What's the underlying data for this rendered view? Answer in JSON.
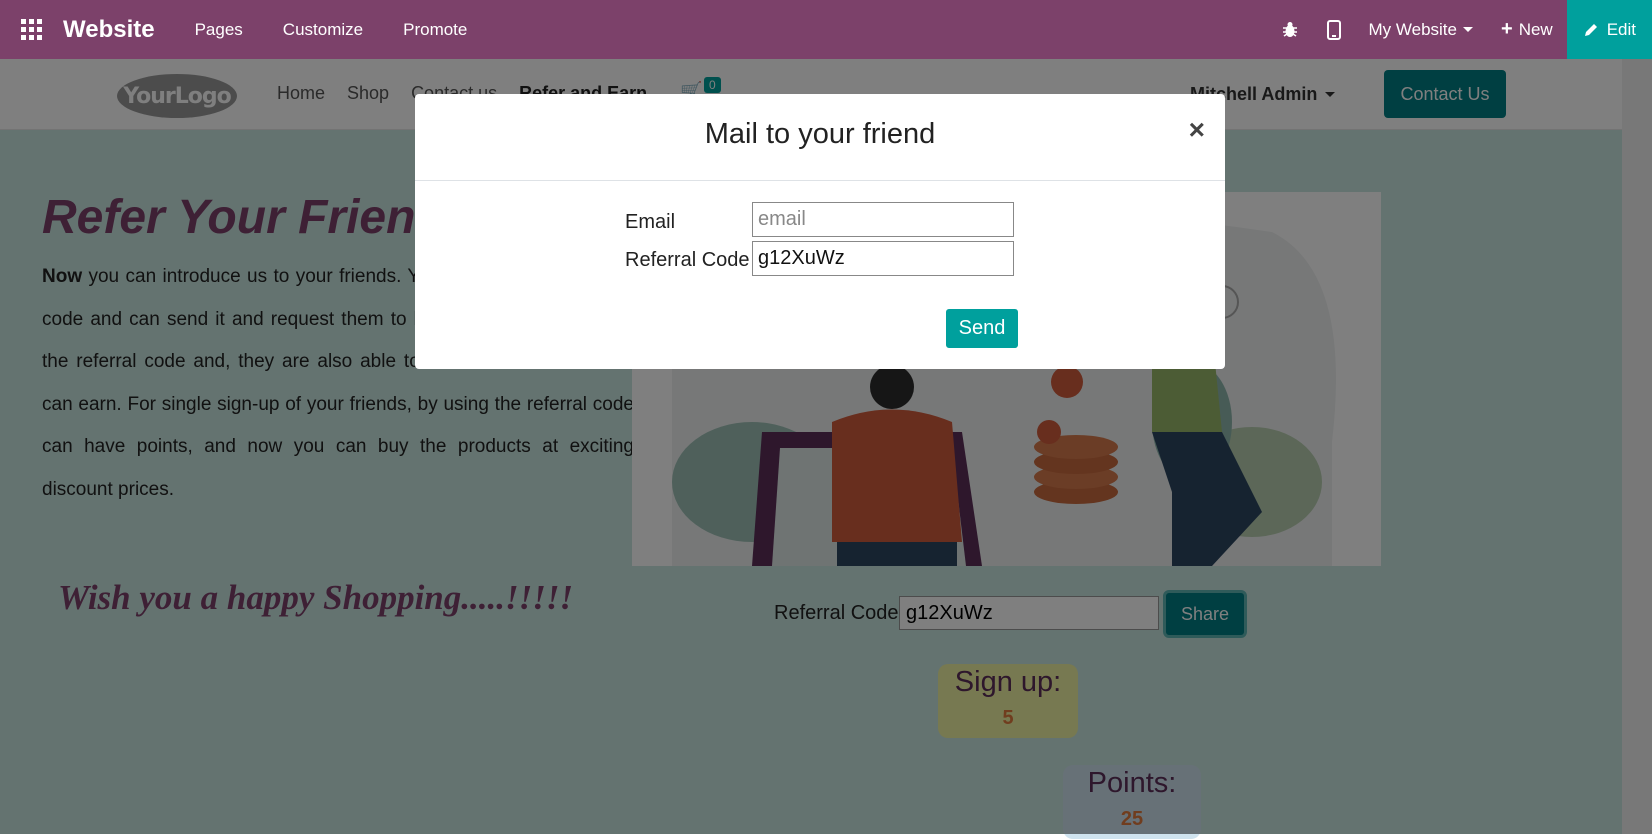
{
  "topbar": {
    "brand": "Website",
    "menu": [
      "Pages",
      "Customize",
      "Promote"
    ],
    "website_selector": "My Website",
    "new_label": "New",
    "edit_label": "Edit"
  },
  "site_header": {
    "logo_text": "YourLogo",
    "nav": [
      "Home",
      "Shop",
      "Contact us",
      "Refer and Earn"
    ],
    "cart_count": "0",
    "user": "Mitchell Admin",
    "contact_button": "Contact Us"
  },
  "page": {
    "title": "Refer Your Friend",
    "intro_bold": "Now",
    "intro_text": " you can introduce us to your friends. You have a unique referral code and can send it and request them to log in to the site by using the referral code and, they are also able to refer another friend and can earn. For single sign-up of your friends, by using the referral code can have points, and now you can buy the products at exciting discount prices.",
    "happy_text": "Wish you a happy Shopping.....!!!!!",
    "referral_label": "Referral Code",
    "referral_value": "g12XuWz",
    "share_label": "Share",
    "signup_title": "Sign up:",
    "signup_value": "5",
    "points_title": "Points:",
    "points_value": "25"
  },
  "modal": {
    "title": "Mail to your friend",
    "close_symbol": "×",
    "email_label": "Email",
    "email_placeholder": "email",
    "referral_label": "Referral Code",
    "referral_value": "g12XuWz",
    "send_label": "Send"
  },
  "colors": {
    "odoo_purple": "#7c416a",
    "teal": "#00a09d",
    "dark_teal": "#017e84"
  }
}
